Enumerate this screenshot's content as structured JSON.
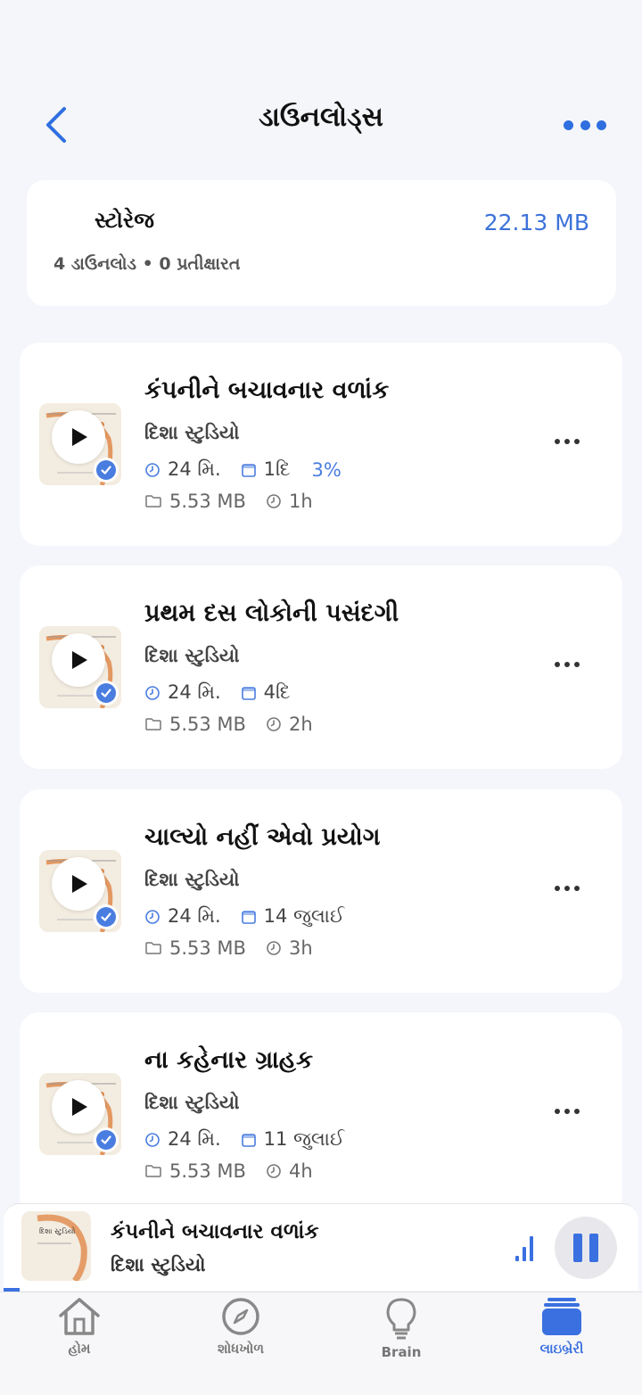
{
  "header": {
    "title": "ડાઉનલોડ્સ"
  },
  "storage": {
    "label": "સ્ટોરેજ",
    "summary": "4 ડાઉનલોડ • 0 પ્રતીક્ષારત",
    "size": "22.13 MB"
  },
  "downloads": [
    {
      "title": "કંપનીને બચાવનાર વળાંક",
      "author": "દિશા સ્ટુડિયો",
      "duration": "24 મિ.",
      "date": "1દિ",
      "progress": "3%",
      "size": "5.53 MB",
      "ago": "1h"
    },
    {
      "title": "પ્રથમ દસ લોકોની પસંદગી",
      "author": "દિશા સ્ટુડિયો",
      "duration": "24 મિ.",
      "date": "4દિ",
      "progress": "",
      "size": "5.53 MB",
      "ago": "2h"
    },
    {
      "title": "ચાલ્યો નહીં એવો પ્રયોગ",
      "author": "દિશા સ્ટુડિયો",
      "duration": "24 મિ.",
      "date": "14 જુલાઈ",
      "progress": "",
      "size": "5.53 MB",
      "ago": "3h"
    },
    {
      "title": "ના કહેનાર ગ્રાહક",
      "author": "દિશા સ્ટુડિયો",
      "duration": "24 મિ.",
      "date": "11 જુલાઈ",
      "progress": "",
      "size": "5.53 MB",
      "ago": "4h"
    }
  ],
  "player": {
    "thumb_label": "દિશા સ્ટુડિયો",
    "title": "કંપનીને બચાવનાર વળાંક",
    "author": "દિશા સ્ટુડિયો"
  },
  "tabs": [
    {
      "label": "હોમ",
      "icon": "home-icon"
    },
    {
      "label": "શોધખોળ",
      "icon": "compass-icon"
    },
    {
      "label": "Brain",
      "icon": "lightbulb-icon"
    },
    {
      "label": "લાઇબ્રેરી",
      "icon": "library-icon"
    }
  ],
  "colors": {
    "accent": "#3a70e0",
    "thumb_arc": "#e08a4a",
    "card_bg": "#ffffff",
    "page_bg": "#f4f6fb"
  }
}
